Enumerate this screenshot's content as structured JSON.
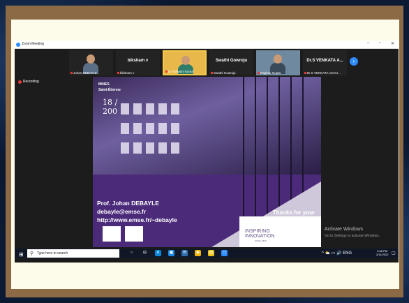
{
  "window": {
    "title": "Zoom Meeting",
    "minimize_icon": "minimize-icon",
    "maximize_icon": "maximize-icon",
    "close_icon": "close-icon"
  },
  "recording": {
    "label": "Recording"
  },
  "participants": [
    {
      "name": "Johan DEBAYLE",
      "display": ""
    },
    {
      "name": "biksham v",
      "display": "biksham v"
    },
    {
      "name": "Dr.Ashwani Kumar",
      "display": ""
    },
    {
      "name": "Swathi Gowroju",
      "display": "Swathi Gowroju"
    },
    {
      "name": "Raghav Gupta",
      "display": ""
    },
    {
      "name": "Dr.S VENKATA ACHU...",
      "display": "Dr.S VENKATA A..."
    }
  ],
  "slide": {
    "logo_line1": "MINES",
    "logo_line2": "Saint-Étienne",
    "logo_line3": "18 / 200",
    "presenter": "Prof. Johan DEBAYLE",
    "email": "debayle@emse.fr",
    "website": "http://www.emse.fr/~debayle",
    "thanks": "Thanks for your attention",
    "tagline1": "INSPIRING",
    "tagline2": "INNOVATION",
    "tagline3": "SINCE 1816"
  },
  "activation": {
    "line1": "Activate Windows",
    "line2": "Go to Settings to activate Windows."
  },
  "taskbar": {
    "search_placeholder": "Type here to search",
    "time": "3:08 PM",
    "date": "2/11/2022",
    "tray_text": "^ ⛅ ▭ 🔊 ENG"
  },
  "colors": {
    "slide_purple": "#4b2a7a",
    "zoom_blue": "#2d8cff",
    "frame_brown": "#8b6a45"
  }
}
